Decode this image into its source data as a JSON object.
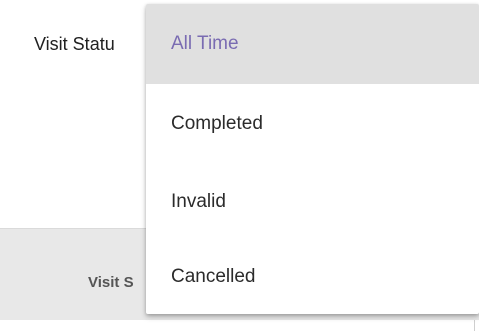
{
  "filter": {
    "label": "Visit Statu"
  },
  "table": {
    "header_cell": "Visit S"
  },
  "dropdown": {
    "options": [
      {
        "label": "All Time",
        "selected": true
      },
      {
        "label": "Completed",
        "selected": false
      },
      {
        "label": "Invalid",
        "selected": false
      },
      {
        "label": "Cancelled",
        "selected": false
      }
    ]
  },
  "colors": {
    "selected_text": "#7a6cb2",
    "selected_bg": "#e0e0e0",
    "header_bg": "#e8e8e8"
  }
}
